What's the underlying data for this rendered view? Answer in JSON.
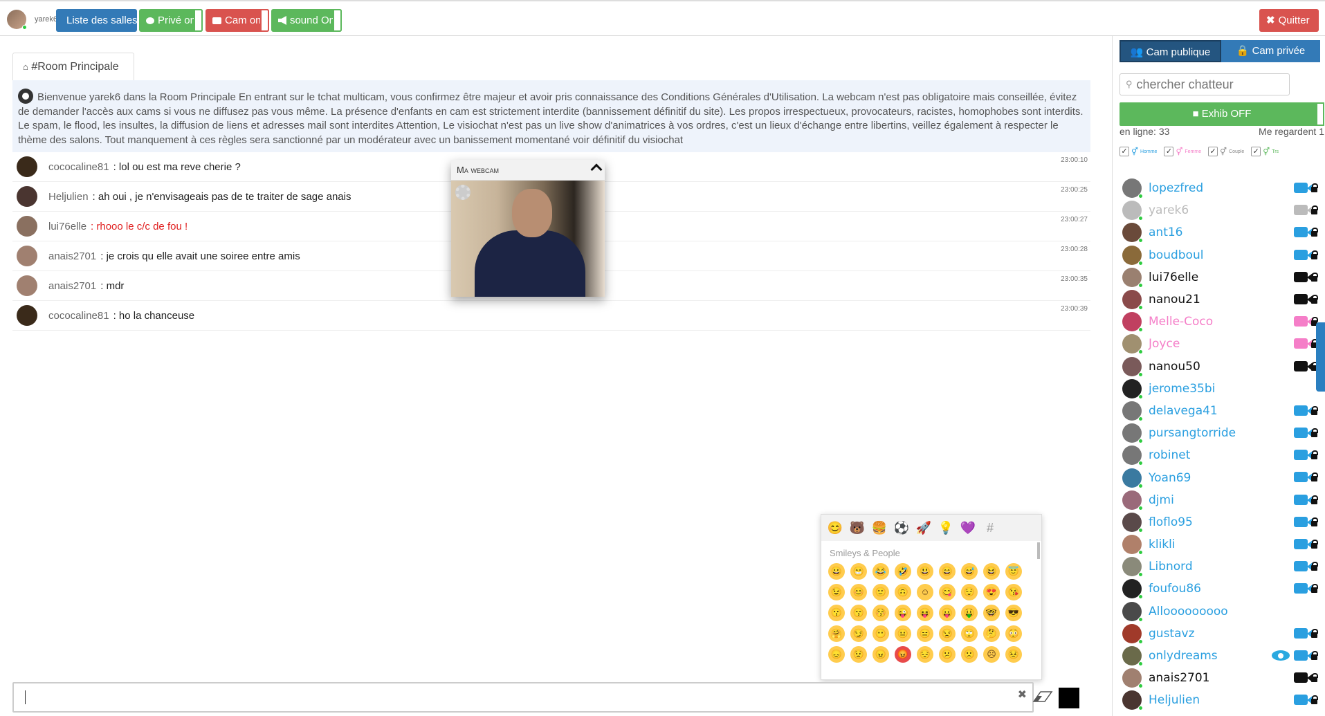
{
  "topbar": {
    "username": "yarek6",
    "buttons": {
      "rooms": "Liste des salles",
      "private": "Privé on",
      "cam": "Cam on",
      "sound": "sound On",
      "quit": "Quitter"
    }
  },
  "room": {
    "tab_label": "#Room Principale",
    "welcome": "Bienvenue yarek6 dans la Room Principale En entrant sur le tchat multicam, vous confirmez être majeur et avoir pris connaissance des Conditions Générales d'Utilisation. La webcam n'est pas obligatoire mais conseillée, évitez de demander l'accès aux cams si vous ne diffusez pas vous même. La présence d'enfants en cam est strictement interdite (bannissement définitif du site). Les propos irrespectueux, provocateurs, racistes, homophobes sont interdits. Le spam, le flood, les insultes, la diffusion de liens et adresses mail sont interdites Attention, Le visiochat n'est pas un live show d'animatrices à vos ordres, c'est un lieux d'échange entre libertins, veillez également à respecter le thème des salons. Tout manquement à ces règles sera sanctionné par un modérateur avec un banissement momentané voir définitif du visiochat"
  },
  "messages": [
    {
      "user": "cococaline81",
      "text": ": lol ou est ma reve cherie ?",
      "time": "23:00:10",
      "red": false,
      "avatar": "#3a2a1a"
    },
    {
      "user": "Heljulien",
      "text": ": ah oui , je n'envisageais pas de te traiter de sage anais",
      "time": "23:00:25",
      "red": false,
      "avatar": "#4a3530"
    },
    {
      "user": "lui76elle",
      "text": ": rhooo le c/c de fou !",
      "time": "23:00:27",
      "red": true,
      "avatar": "#8a7060"
    },
    {
      "user": "anais2701",
      "text": ": je crois qu elle avait une soiree entre amis",
      "time": "23:00:28",
      "red": false,
      "avatar": "#a08070"
    },
    {
      "user": "anais2701",
      "text": ": mdr",
      "time": "23:00:35",
      "red": false,
      "avatar": "#a08070"
    },
    {
      "user": "cococaline81",
      "text": ": ho la chanceuse",
      "time": "23:00:39",
      "red": false,
      "avatar": "#3a2a1a"
    }
  ],
  "webcam": {
    "title": "Ma webcam"
  },
  "emoji": {
    "category_title": "Smileys & People",
    "categories": [
      "😊",
      "🐻",
      "🍔",
      "⚽",
      "🚀",
      "💡",
      "💜",
      "#"
    ],
    "items": [
      "😀",
      "😁",
      "😂",
      "🤣",
      "😃",
      "😄",
      "😅",
      "😆",
      "😇",
      "😉",
      "😊",
      "🙂",
      "🙃",
      "☺",
      "😋",
      "😌",
      "😍",
      "😘",
      "😗",
      "😙",
      "😚",
      "😜",
      "😝",
      "😛",
      "🤑",
      "🤓",
      "😎",
      "🤗",
      "😏",
      "😶",
      "😐",
      "😑",
      "😒",
      "🙄",
      "🤔",
      "😳",
      "😞",
      "😟",
      "😠",
      "😡",
      "😔",
      "😕",
      "🙁",
      "☹",
      "😣"
    ]
  },
  "input": {
    "placeholder": ""
  },
  "sidebar": {
    "tabs": {
      "public": "Cam publique",
      "private": "Cam privée"
    },
    "search_placeholder": "chercher chatteur",
    "exhib": "Exhib OFF",
    "online": "en ligne: 33",
    "watching": "Me regardent 1",
    "filters": [
      "Homme",
      "Femme",
      "Couple",
      "Trs"
    ],
    "colors": {
      "blue": "#2a9fe0",
      "pink": "#f57ec8",
      "black": "#111111",
      "grey": "#bbbbbb",
      "green": "#5cb85c"
    },
    "users": [
      {
        "name": "lopezfred",
        "color": "#2a9fe0",
        "cam": "#2a9fe0",
        "lock": true,
        "eye": false,
        "avatar": "#777"
      },
      {
        "name": "yarek6",
        "color": "#bbbbbb",
        "cam": "#bbbbbb",
        "lock": true,
        "eye": false,
        "avatar": "#bbb"
      },
      {
        "name": "ant16",
        "color": "#2a9fe0",
        "cam": "#2a9fe0",
        "lock": true,
        "eye": false,
        "avatar": "#6a4a3a"
      },
      {
        "name": "boudboul",
        "color": "#2a9fe0",
        "cam": "#2a9fe0",
        "lock": true,
        "eye": false,
        "avatar": "#8a6a3a"
      },
      {
        "name": "lui76elle",
        "color": "#111111",
        "cam": "#111111",
        "lock": true,
        "eye": false,
        "avatar": "#9a8070"
      },
      {
        "name": "nanou21",
        "color": "#111111",
        "cam": "#111111",
        "lock": true,
        "eye": false,
        "avatar": "#8a4a4a"
      },
      {
        "name": "Melle-Coco",
        "color": "#f57ec8",
        "cam": "#f57ec8",
        "lock": true,
        "eye": false,
        "avatar": "#c04060"
      },
      {
        "name": "Joyce",
        "color": "#f57ec8",
        "cam": "#f57ec8",
        "lock": true,
        "eye": false,
        "avatar": "#a09070"
      },
      {
        "name": "nanou50",
        "color": "#111111",
        "cam": "#111111",
        "lock": true,
        "eye": false,
        "avatar": "#7a5a5a"
      },
      {
        "name": "jerome35bi",
        "color": "#2a9fe0",
        "cam": "",
        "lock": false,
        "eye": false,
        "avatar": "#222"
      },
      {
        "name": "delavega41",
        "color": "#2a9fe0",
        "cam": "#2a9fe0",
        "lock": true,
        "eye": false,
        "avatar": "#777"
      },
      {
        "name": "pursangtorride",
        "color": "#2a9fe0",
        "cam": "#2a9fe0",
        "lock": true,
        "eye": false,
        "avatar": "#777"
      },
      {
        "name": "robinet",
        "color": "#2a9fe0",
        "cam": "#2a9fe0",
        "lock": true,
        "eye": false,
        "avatar": "#777"
      },
      {
        "name": "Yoan69",
        "color": "#2a9fe0",
        "cam": "#2a9fe0",
        "lock": true,
        "eye": false,
        "avatar": "#3a7aa0"
      },
      {
        "name": "djmi",
        "color": "#2a9fe0",
        "cam": "#2a9fe0",
        "lock": true,
        "eye": false,
        "avatar": "#9a6a7a"
      },
      {
        "name": "floflo95",
        "color": "#2a9fe0",
        "cam": "#2a9fe0",
        "lock": true,
        "eye": false,
        "avatar": "#5a4a4a"
      },
      {
        "name": "klikli",
        "color": "#2a9fe0",
        "cam": "#2a9fe0",
        "lock": true,
        "eye": false,
        "avatar": "#b0806a"
      },
      {
        "name": "Libnord",
        "color": "#2a9fe0",
        "cam": "#2a9fe0",
        "lock": true,
        "eye": false,
        "avatar": "#8a8a7a"
      },
      {
        "name": "foufou86",
        "color": "#2a9fe0",
        "cam": "#2a9fe0",
        "lock": true,
        "eye": false,
        "avatar": "#222"
      },
      {
        "name": "Allooooooooo",
        "color": "#2a9fe0",
        "cam": "",
        "lock": false,
        "eye": false,
        "avatar": "#4a4a4a"
      },
      {
        "name": "gustavz",
        "color": "#2a9fe0",
        "cam": "#2a9fe0",
        "lock": true,
        "eye": false,
        "avatar": "#a03a2a"
      },
      {
        "name": "onlydreams",
        "color": "#2a9fe0",
        "cam": "#2a9fe0",
        "lock": true,
        "eye": true,
        "avatar": "#6a6a4a"
      },
      {
        "name": "anais2701",
        "color": "#111111",
        "cam": "#111111",
        "lock": true,
        "eye": false,
        "avatar": "#a08070"
      },
      {
        "name": "Heljulien",
        "color": "#2a9fe0",
        "cam": "#2a9fe0",
        "lock": true,
        "eye": false,
        "avatar": "#4a3530"
      }
    ]
  }
}
